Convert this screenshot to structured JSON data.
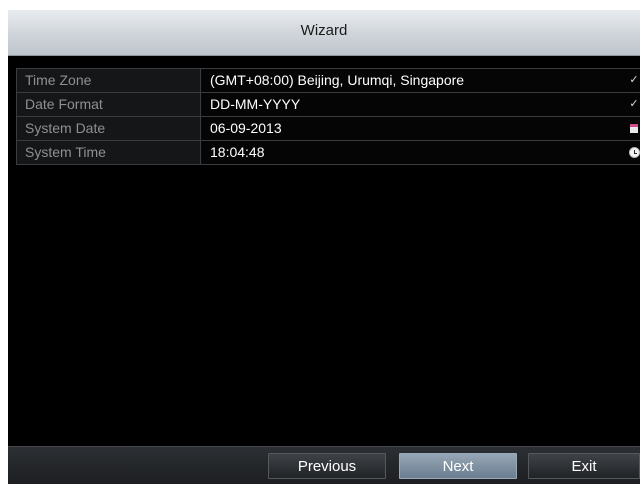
{
  "window": {
    "title": "Wizard"
  },
  "settings": [
    {
      "label": "Time Zone",
      "value": "(GMT+08:00) Beijing, Urumqi, Singapore",
      "control": "chevron-down-icon"
    },
    {
      "label": "Date Format",
      "value": "DD-MM-YYYY",
      "control": "chevron-down-icon"
    },
    {
      "label": "System Date",
      "value": "06-09-2013",
      "control": "calendar-icon"
    },
    {
      "label": "System Time",
      "value": "18:04:48",
      "control": "clock-icon"
    }
  ],
  "buttons": {
    "previous": "Previous",
    "next": "Next",
    "exit": "Exit"
  },
  "colors": {
    "titlebar": "#cfd4da",
    "background": "#000000",
    "label_text": "#8d9094",
    "value_text": "#ffffff",
    "active_button": "#7f90a3",
    "calendar_accent": "#d04a8a"
  }
}
